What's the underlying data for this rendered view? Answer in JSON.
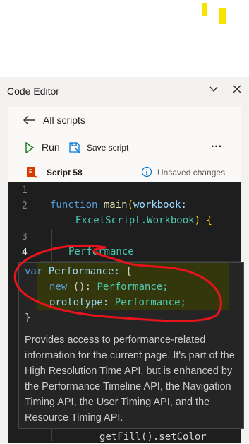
{
  "panel": {
    "title": "Code Editor",
    "chevron_icon": "chevron-down-icon",
    "close_icon": "close-icon"
  },
  "nav": {
    "back_label": "All scripts"
  },
  "toolbar": {
    "run_label": "Run",
    "save_label": "Save script",
    "more_label": "···"
  },
  "script": {
    "name": "Script 58",
    "status": "Unsaved changes"
  },
  "editor": {
    "line_numbers": [
      "1",
      "2",
      "3",
      "4"
    ],
    "line2_keyword": "function",
    "line2_fn": "main",
    "line2_open": "(",
    "line2_param": "workbook:",
    "line2b_type": "ExcelScript.Workbook",
    "line2b_close": ")",
    "line2b_brace": "{",
    "line4_text": "Performance",
    "bottom_text": "getFill().setColor"
  },
  "tooltip": {
    "sig_var": "var",
    "sig_name": "Performance:",
    "sig_open": "{",
    "sig_new": "new",
    "sig_new_rest": "():",
    "sig_new_type": "Performance;",
    "sig_proto": "prototype:",
    "sig_proto_type": "Performance;",
    "sig_close": "}",
    "doc": "Provides access to performance-related information for the current page. It's part of the High Resolution Time API, but is enhanced by the Performance Timeline API, the Navigation Timing API, the User Timing API, and the Resource Timing API."
  },
  "colors": {
    "annotation": "#e8141c",
    "highlight": "#f5e400"
  }
}
